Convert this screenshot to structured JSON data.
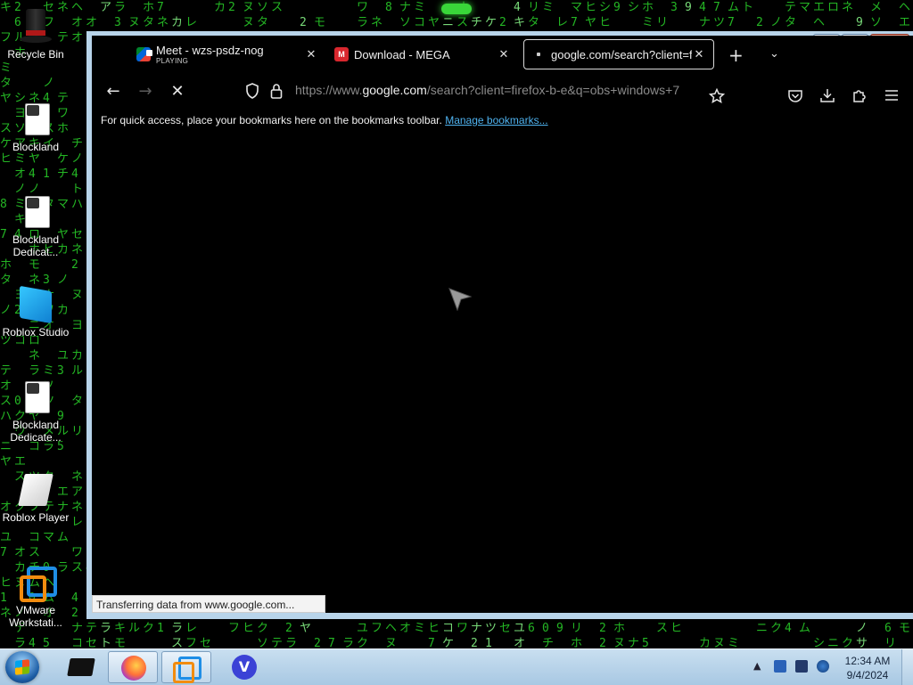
{
  "desktop": {
    "icons": [
      {
        "label": "Recycle Bin"
      },
      {
        "label": "Blockland"
      },
      {
        "label": "Blockland Dedicat..."
      },
      {
        "label": "Roblox Studio"
      },
      {
        "label": "Blockland Dedicate..."
      },
      {
        "label": "Roblox Player"
      },
      {
        "label": "VMware Workstati..."
      }
    ]
  },
  "browser": {
    "tabs": [
      {
        "title": "Meet - wzs-psdz-nog",
        "subtitle": "PLAYING",
        "icon": "google-meet-icon"
      },
      {
        "title": "Download - MEGA",
        "icon": "mega-icon"
      },
      {
        "title": "google.com/search?client=fire",
        "icon": "loading-icon"
      }
    ],
    "url": {
      "prefix": "https://www.",
      "domain": "google.com",
      "path": "/search?client=firefox-b-e&q=obs+windows+7"
    },
    "bookmarks_bar": {
      "message": "For quick access, place your bookmarks here on the bookmarks toolbar.",
      "link": "Manage bookmarks..."
    },
    "status_text": "Transferring data from www.google.com..."
  },
  "window_controls": {
    "minimize": "▭",
    "maximize": "⧉",
    "close": "✕"
  },
  "taskbar": {
    "clock_time": "12:34 AM",
    "clock_date": "9/4/2024"
  },
  "colors": {
    "matrix_green": "#2bd62b",
    "link_blue": "#4fb3f0",
    "taskbar": "#b8d4ea"
  }
}
